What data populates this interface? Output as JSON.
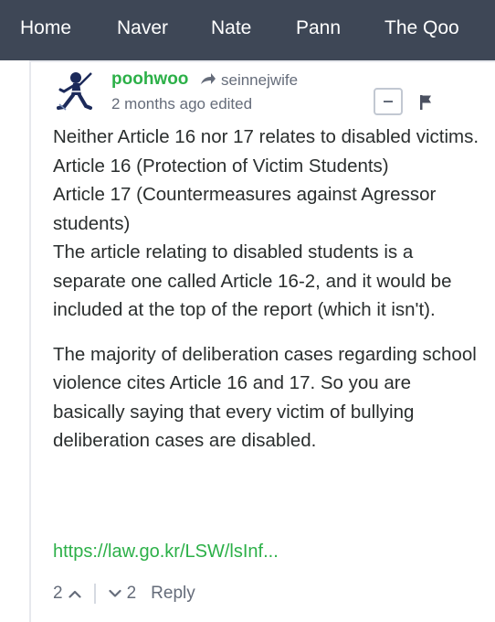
{
  "nav": {
    "items": [
      {
        "label": "Home"
      },
      {
        "label": "Naver"
      },
      {
        "label": "Nate"
      },
      {
        "label": "Pann"
      },
      {
        "label": "The Qoo"
      }
    ]
  },
  "comment": {
    "author": "poohwoo",
    "reply_to": "seinnejwife",
    "meta": "2 months ago edited",
    "body_lines": [
      "Neither Article 16 nor 17 relates to disabled victims.",
      "Article 16 (Protection of Victim Students)",
      "Article 17 (Countermeasures against Agressor students)",
      "The article relating to disabled students is a separate one called Article 16-2, and it would be included at the top of the report (which it isn't).",
      "The majority of deliberation cases regarding school violence cites Article 16 and 17. So you are basically saying that every victim of bullying deliberation cases are disabled."
    ],
    "link": "https://law.go.kr/LSW/lsInf...",
    "upvotes": "2",
    "downvotes": "2",
    "reply_label": "Reply"
  },
  "colors": {
    "nav_bg": "#3e4756",
    "accent_green": "#2cb048",
    "muted_text": "#656c7a",
    "body_text": "#2a2e2e"
  },
  "icons": {
    "avatar": "fencer-avatar-icon",
    "reply_arrow": "reply-arrow-icon",
    "collapse": "minus-icon",
    "flag": "flag-icon",
    "upvote": "chevron-up-icon",
    "downvote": "chevron-down-icon"
  }
}
